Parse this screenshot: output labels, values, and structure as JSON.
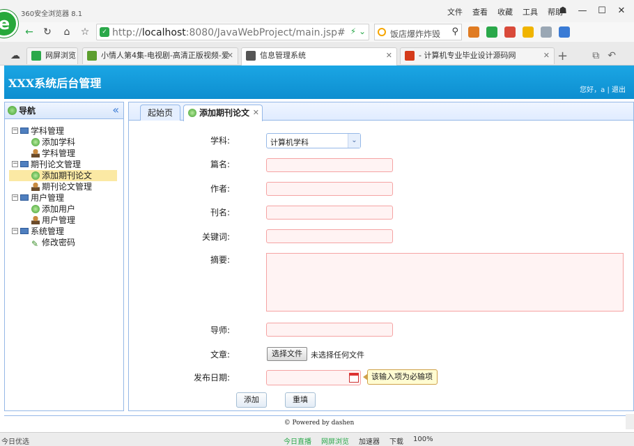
{
  "browser": {
    "title": "360安全浏览器 8.1",
    "menu": [
      "文件",
      "查看",
      "收藏",
      "工具",
      "帮助"
    ],
    "url_host": "localhost",
    "url_prefix": "http://",
    "url_rest": ":8080/JavaWebProject/main.jsp#",
    "search_placeholder": "饭店爆炸炸毁",
    "tabs": [
      {
        "label": "网屏浏览",
        "icon_color": "#2aa84a"
      },
      {
        "label": "小情人第4集-电视剧-高清正版视频-爱",
        "icon_color": "#5c9e2e"
      },
      {
        "label": "信息管理系统",
        "icon_color": "#555555",
        "active": true
      },
      {
        "label": "- 计算机专业毕业设计源码网",
        "icon_color": "#d43a1a"
      }
    ],
    "status_left": "今日优选",
    "status_items": [
      "今日直播",
      "网屏浏览",
      "加速器",
      "下载",
      "100%"
    ]
  },
  "header": {
    "title": "XXX系统后台管理",
    "greeting": "您好，a",
    "separator": "|",
    "logout": "退出"
  },
  "nav": {
    "title": "导航",
    "collapse": "«",
    "tree": [
      {
        "label": "学科管理",
        "children": [
          "添加学科",
          "学科管理"
        ]
      },
      {
        "label": "期刊论文管理",
        "children": [
          "添加期刊论文",
          "期刊论文管理"
        ]
      },
      {
        "label": "用户管理",
        "children": [
          "添加用户",
          "用户管理"
        ]
      },
      {
        "label": "系统管理",
        "children": [
          "修改密码"
        ]
      }
    ]
  },
  "content_tabs": [
    "起始页",
    "添加期刊论文"
  ],
  "form": {
    "subject_label": "学科:",
    "subject_value": "计算机学科",
    "title_label": "篇名:",
    "author_label": "作者:",
    "journal_label": "刊名:",
    "keywords_label": "关键词:",
    "abstract_label": "摘要:",
    "advisor_label": "导师:",
    "article_label": "文章:",
    "file_button": "选择文件",
    "file_status": "未选择任何文件",
    "date_label": "发布日期:",
    "date_tooltip": "该输入项为必输项",
    "submit": "添加",
    "reset": "重填"
  },
  "footer": "© Powered by dashen"
}
